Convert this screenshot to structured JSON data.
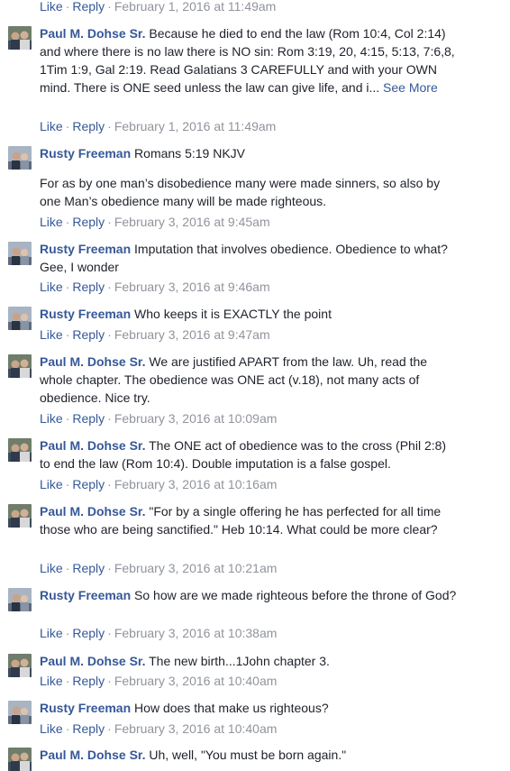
{
  "top_meta": {
    "like": "Like",
    "reply": "Reply",
    "sep": "·",
    "time": "February 1, 2016 at 11:49am"
  },
  "comments": [
    {
      "author": "Paul M. Dohse Sr.",
      "text": "Because he died to end the law (Rom 10:4, Col 2:14) and where there is no law there is NO sin: Rom 3:19, 20, 4:15, 5:13, 7:6,8, 1Tim 1:9, Gal 2:19. Read Galatians 3 CAREFULLY and with your OWN mind. There is ONE seed unless the law can give life, and i...",
      "see_more": " See More",
      "like": "Like",
      "reply": "Reply",
      "sep": "·",
      "time": "February 1, 2016 at 11:49am"
    },
    {
      "author": "Rusty Freeman",
      "text": "Romans 5:19 NKJV",
      "para": "For as by one man’s disobedience many were made sinners, so also by one Man’s obedience many will be made righteous.",
      "like": "Like",
      "reply": "Reply",
      "sep": "·",
      "time": "February 3, 2016 at 9:45am"
    },
    {
      "author": "Rusty Freeman",
      "text": "Imputation that involves obedience. Obedience to what? Gee, I wonder",
      "like": "Like",
      "reply": "Reply",
      "sep": "·",
      "time": "February 3, 2016 at 9:46am"
    },
    {
      "author": "Rusty Freeman",
      "text": "Who keeps it is EXACTLY the point",
      "like": "Like",
      "reply": "Reply",
      "sep": "·",
      "time": "February 3, 2016 at 9:47am"
    },
    {
      "author": "Paul M. Dohse Sr.",
      "text": "We are justified APART from the law. Uh, read the whole chapter. The obedience was ONE act (v.18), not many acts of obedience. Nice try.",
      "like": "Like",
      "reply": "Reply",
      "sep": "·",
      "time": "February 3, 2016 at 10:09am"
    },
    {
      "author": "Paul M. Dohse Sr.",
      "text": "The ONE act of obedience was to the cross (Phil 2:8) to end the law (Rom 10:4). Double imputation is a false gospel.",
      "like": "Like",
      "reply": "Reply",
      "sep": "·",
      "time": "February 3, 2016 at 10:16am"
    },
    {
      "author": "Paul M. Dohse Sr.",
      "text": "\"For by a single offering he has perfected for all time those who are being sanctified.\" Heb 10:14. What could be more clear?",
      "like": "Like",
      "reply": "Reply",
      "sep": "·",
      "time": "February 3, 2016 at 10:21am"
    },
    {
      "author": "Rusty Freeman",
      "text": "So how are we made righteous before the throne of God?",
      "like": "Like",
      "reply": "Reply",
      "sep": "·",
      "time": "February 3, 2016 at 10:38am"
    },
    {
      "author": "Paul M. Dohse Sr.",
      "text": "The new birth...1John chapter 3.",
      "like": "Like",
      "reply": "Reply",
      "sep": "·",
      "time": "February 3, 2016 at 10:40am"
    },
    {
      "author": "Rusty Freeman",
      "text": "How does that make us righteous?",
      "like": "Like",
      "reply": "Reply",
      "sep": "·",
      "time": "February 3, 2016 at 10:40am"
    },
    {
      "author": "Paul M. Dohse Sr.",
      "text": "Uh, well, \"You must be born again.\""
    }
  ],
  "colors": {
    "link": "#365899",
    "text": "#1d2129",
    "meta": "#90949c"
  }
}
